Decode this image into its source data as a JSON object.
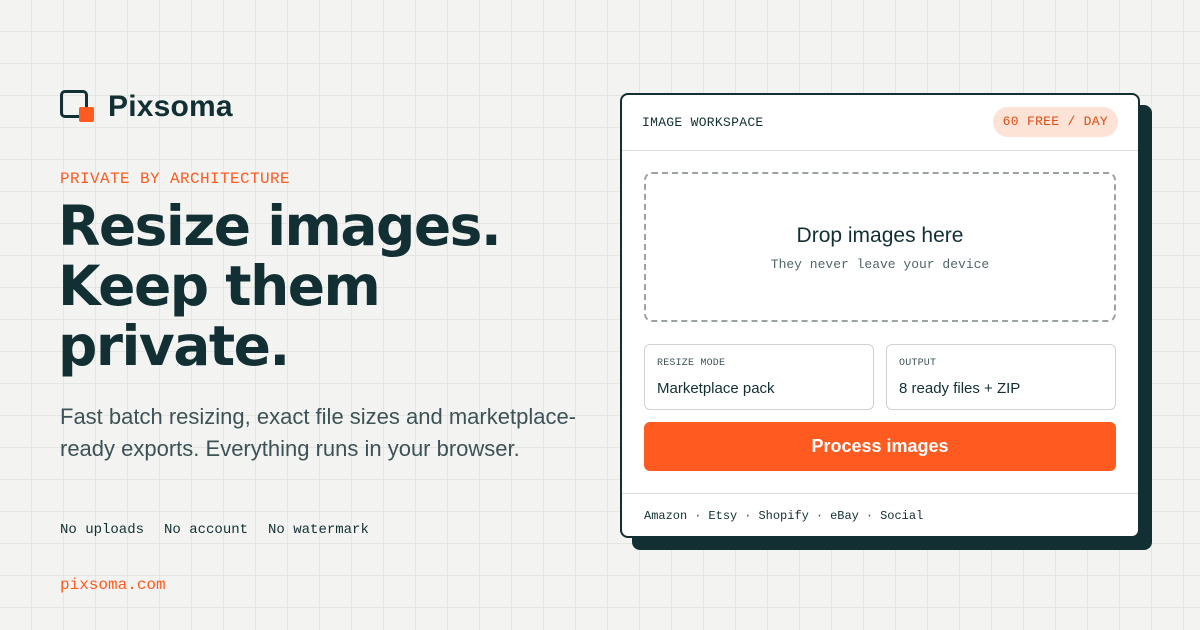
{
  "brand": {
    "name": "Pixsoma",
    "accent": "#ff5a1f",
    "ink": "#123033"
  },
  "hero": {
    "eyebrow": "PRIVATE BY ARCHITECTURE",
    "headline": [
      "Resize images.",
      "Keep them",
      "private."
    ],
    "lede": "Fast batch resizing, exact file sizes and marketplace-ready exports. Everything runs in your browser.",
    "tags": [
      "No uploads",
      "No account",
      "No watermark"
    ],
    "site": "pixsoma.com"
  },
  "workspace": {
    "title": "IMAGE WORKSPACE",
    "quota_badge": "60 FREE / DAY",
    "dropzone": {
      "title": "Drop images here",
      "subtitle": "They never leave your device"
    },
    "resize_mode": {
      "label": "RESIZE MODE",
      "value": "Marketplace pack"
    },
    "output": {
      "label": "OUTPUT",
      "value": "8 ready files + ZIP"
    },
    "process_button": "Process images",
    "platforms": [
      "Amazon",
      "Etsy",
      "Shopify",
      "eBay",
      "Social"
    ],
    "platform_separator": "·"
  }
}
